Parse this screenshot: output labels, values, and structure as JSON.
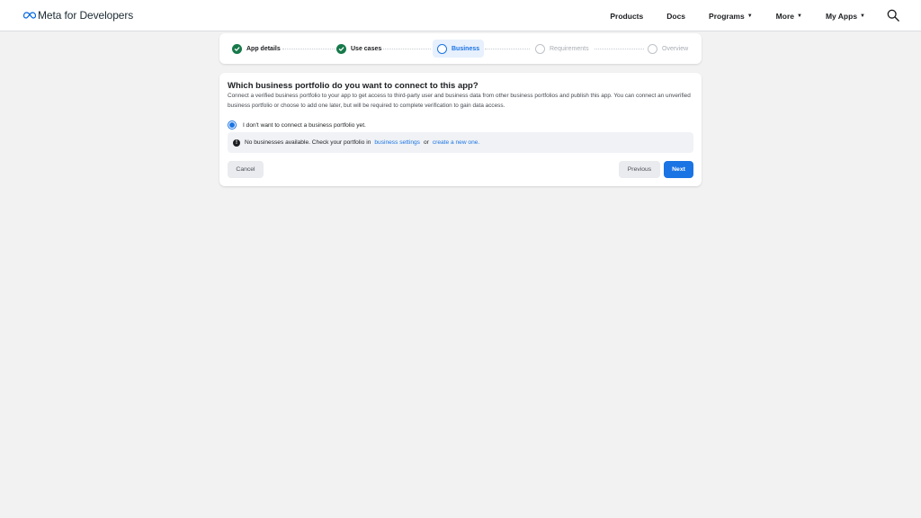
{
  "nav": {
    "brand": "Meta for Developers",
    "links": [
      {
        "label": "Products",
        "caret": false
      },
      {
        "label": "Docs",
        "caret": false
      },
      {
        "label": "Programs",
        "caret": true
      },
      {
        "label": "More",
        "caret": true
      },
      {
        "label": "My Apps",
        "caret": true
      }
    ],
    "search_icon": "search-icon"
  },
  "stepper": {
    "steps": [
      {
        "label": "App details",
        "state": "done"
      },
      {
        "label": "Use cases",
        "state": "done"
      },
      {
        "label": "Business",
        "state": "active"
      },
      {
        "label": "Requirements",
        "state": "todo"
      },
      {
        "label": "Overview",
        "state": "todo"
      }
    ]
  },
  "card": {
    "title": "Which business portfolio do you want to connect to this app?",
    "description": "Connect a verified business portfolio to your app to get access to third-party user and business data from other business portfolios and publish this app. You can connect an unverified business portfolio or choose to add one later, but will be required to complete verification to gain data access.",
    "radio_label": "I don't want to connect a business portfolio yet.",
    "notice": {
      "text_before": "No businesses available. Check your portfolio in",
      "link1": "business settings",
      "text_mid": "or",
      "link2": "create a new one."
    },
    "cancel_label": "Cancel",
    "previous_label": "Previous",
    "next_label": "Next"
  },
  "colors": {
    "accent": "#1b74e4",
    "success": "#17794a",
    "background": "#f2f2f2"
  }
}
